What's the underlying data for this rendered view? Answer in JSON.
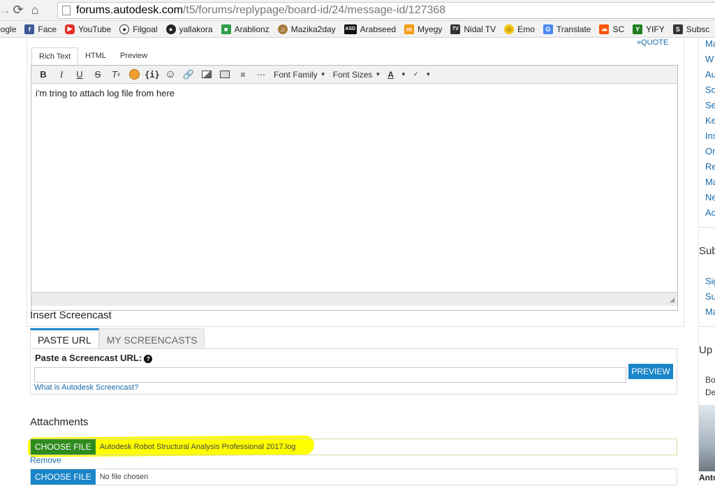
{
  "browser": {
    "url_host": "forums.autodesk.com",
    "url_path": "/t5/forums/replypage/board-id/24/message-id/127368",
    "bookmarks": [
      {
        "label": "oogle",
        "icon": "google-icon",
        "color": "#4285f4"
      },
      {
        "label": "Face",
        "icon": "facebook-icon",
        "color": "#3b5998"
      },
      {
        "label": "YouTube",
        "icon": "youtube-icon",
        "color": "#e52d27"
      },
      {
        "label": "Filgoal",
        "icon": "football-icon",
        "color": "#222222"
      },
      {
        "label": "yallakora",
        "icon": "football-icon",
        "color": "#222222"
      },
      {
        "label": "Arablionz",
        "icon": "camera-icon",
        "color": "#2e9d47"
      },
      {
        "label": "Mazika2day",
        "icon": "mazika-icon",
        "color": "#a77b3a"
      },
      {
        "label": "Arabseed",
        "icon": "asd-icon",
        "color": "#111111"
      },
      {
        "label": "Myegy",
        "icon": "myegy-icon",
        "color": "#f39c12"
      },
      {
        "label": "Nidal TV",
        "icon": "tv-icon",
        "color": "#333333"
      },
      {
        "label": "Emo",
        "icon": "smiley-icon",
        "color": "#f1c40f"
      },
      {
        "label": "Translate",
        "icon": "translate-icon",
        "color": "#4a8af4"
      },
      {
        "label": "SC",
        "icon": "soundcloud-icon",
        "color": "#ff5500"
      },
      {
        "label": "YIFY",
        "icon": "yify-icon",
        "color": "#1e7e1e"
      },
      {
        "label": "Subsc",
        "icon": "subscene-icon",
        "color": "#333333"
      }
    ]
  },
  "editor": {
    "tabs": [
      "Rich Text",
      "HTML",
      "Preview"
    ],
    "quote_label": "»QUOTE",
    "font_family_label": "Font Family",
    "font_sizes_label": "Font Sizes",
    "body_text": "i'm tring to attach log file from here"
  },
  "screencast": {
    "title": "Insert Screencast",
    "tabs": [
      "PASTE URL",
      "MY SCREENCASTS"
    ],
    "url_label": "Paste a Screencast URL:",
    "help_glyph": "?",
    "preview_label": "PREVIEW",
    "what_link": "What is Autodesk Screencast?"
  },
  "attachments": {
    "title": "Attachments",
    "choose_label": "CHOOSE FILE",
    "file1_name": "Autodesk Robot Structural Analysis Professional 2017.log",
    "remove_label": "Remove",
    "file2_name": "No file chosen"
  },
  "sidebar": {
    "links1": [
      "Ma",
      "W",
      "Au",
      "So",
      "Se",
      "Ke",
      "Ins",
      "On",
      "Re",
      "Ma",
      "Ne",
      "Ac"
    ],
    "heading1": "Sub",
    "links2": [
      "Sig",
      "Su",
      "Ma"
    ],
    "heading2": "Up",
    "text1": "Bo",
    "text2": "De",
    "caption": "Anto"
  },
  "colors": {
    "accent": "#1a85c8",
    "choose_green": "#2e8b1e",
    "highlight": "#ffff00",
    "link": "#1a6aa8"
  }
}
